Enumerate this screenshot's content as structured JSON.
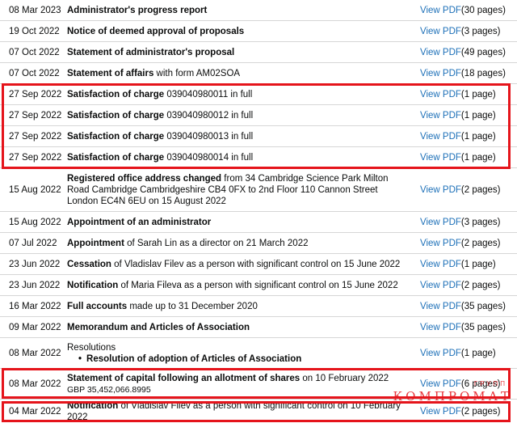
{
  "rows": [
    {
      "date": "08 Mar 2023",
      "bold": "Administrator's progress report",
      "rest": "",
      "link": "View PDF",
      "pages": "(30 pages)"
    },
    {
      "date": "19 Oct 2022",
      "bold": "Notice of deemed approval of proposals",
      "rest": "",
      "link": "View PDF",
      "pages": "(3 pages)"
    },
    {
      "date": "07 Oct 2022",
      "bold": "Statement of administrator's proposal",
      "rest": "",
      "link": "View PDF",
      "pages": "(49 pages)"
    },
    {
      "date": "07 Oct 2022",
      "bold": "Statement of affairs",
      "rest": " with form AM02SOA",
      "link": "View PDF",
      "pages": "(18 pages)"
    },
    {
      "date": "27 Sep 2022",
      "bold": "Satisfaction of charge",
      "rest": " 039040980011 in full",
      "link": "View PDF",
      "pages": "(1 page)"
    },
    {
      "date": "27 Sep 2022",
      "bold": "Satisfaction of charge",
      "rest": " 039040980012 in full",
      "link": "View PDF",
      "pages": "(1 page)"
    },
    {
      "date": "27 Sep 2022",
      "bold": "Satisfaction of charge",
      "rest": " 039040980013 in full",
      "link": "View PDF",
      "pages": "(1 page)"
    },
    {
      "date": "27 Sep 2022",
      "bold": "Satisfaction of charge",
      "rest": " 039040980014 in full",
      "link": "View PDF",
      "pages": "(1 page)"
    },
    {
      "date": "15 Aug 2022",
      "bold": "Registered office address changed",
      "rest": " from 34 Cambridge Science Park Milton Road Cambridge Cambridgeshire CB4 0FX to 2nd Floor 110 Cannon Street London EC4N 6EU on 15 August 2022",
      "link": "View PDF",
      "pages": "(2 pages)"
    },
    {
      "date": "15 Aug 2022",
      "bold": "Appointment of an administrator",
      "rest": "",
      "link": "View PDF",
      "pages": "(3 pages)"
    },
    {
      "date": "07 Jul 2022",
      "bold": "Appointment",
      "rest": " of Sarah Lin as a director on 21 March 2022",
      "link": "View PDF",
      "pages": "(2 pages)"
    },
    {
      "date": "23 Jun 2022",
      "bold": "Cessation",
      "rest": " of Vladislav Filev as a person with significant control on 15 June 2022",
      "link": "View PDF",
      "pages": "(1 page)"
    },
    {
      "date": "23 Jun 2022",
      "bold": "Notification",
      "rest": " of Maria Fileva as a person with significant control on 15 June 2022",
      "link": "View PDF",
      "pages": "(2 pages)"
    },
    {
      "date": "16 Mar 2022",
      "bold": "Full accounts",
      "rest": " made up to 31 December 2020",
      "link": "View PDF",
      "pages": "(35 pages)"
    },
    {
      "date": "09 Mar 2022",
      "bold": "Memorandum and Articles of Association",
      "rest": "",
      "link": "View PDF",
      "pages": "(35 pages)"
    }
  ],
  "resolutions_row": {
    "date": "08 Mar 2022",
    "title": "Resolutions",
    "bullet": "Resolution of adoption of Articles of Association",
    "link": "View PDF",
    "pages": "(1 page)"
  },
  "capital_row": {
    "date": "08 Mar 2022",
    "bold": "Statement of capital following an allotment of shares",
    "rest": " on 10 February 2022",
    "amount": "GBP 35,452,066.8995",
    "link": "View PDF",
    "pages": "(6 pages)"
  },
  "last_row": {
    "date": "04 Mar 2022",
    "bold": "Notification",
    "rest": " of Vladislav Filev as a person with significant control on 10 February 2022",
    "link": "View PDF",
    "pages": "(2 pages)"
  },
  "watermark": {
    "small": "ГРУПП",
    "big": "КОМПРОМАТ"
  },
  "colors": {
    "link": "#1d70b8",
    "highlight": "#e5141b",
    "divider": "#d6d6d6"
  }
}
